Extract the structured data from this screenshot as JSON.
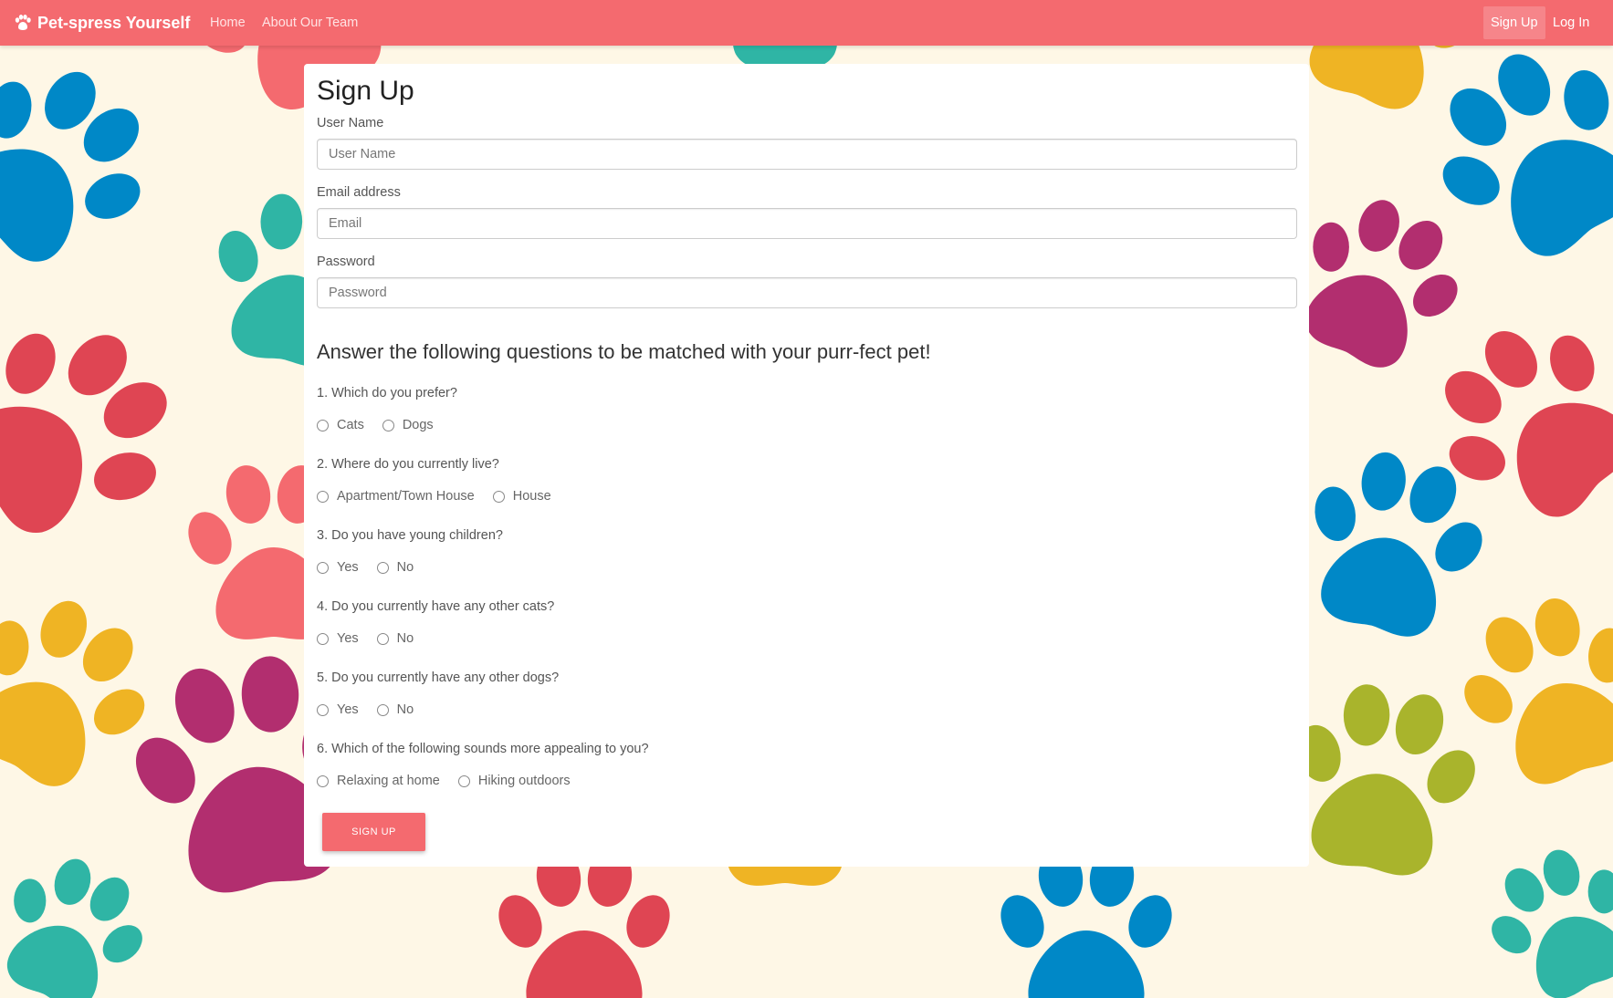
{
  "colors": {
    "brand": "#f46a6f",
    "background": "#fef7e6",
    "paw_colors": [
      "#0088c7",
      "#2fb5a5",
      "#df4553",
      "#b22e6f",
      "#f46a6f",
      "#efb424",
      "#a9b42c"
    ]
  },
  "navbar": {
    "brand_icon": "paw-icon",
    "brand": "Pet-spress Yourself",
    "links": [
      "Home",
      "About Our Team"
    ],
    "right_links": [
      "Sign Up",
      "Log In"
    ]
  },
  "form": {
    "title": "Sign Up",
    "fields": [
      {
        "label": "User Name",
        "placeholder": "User Name"
      },
      {
        "label": "Email address",
        "placeholder": "Email"
      },
      {
        "label": "Password",
        "placeholder": "Password"
      }
    ],
    "subtitle": "Answer the following questions to be matched with your purr-fect pet!",
    "questions": [
      {
        "text": "1. Which do you prefer?",
        "options": [
          "Cats",
          "Dogs"
        ]
      },
      {
        "text": "2. Where do you currently live?",
        "options": [
          "Apartment/Town House",
          "House"
        ]
      },
      {
        "text": "3. Do you have young children?",
        "options": [
          "Yes",
          "No"
        ]
      },
      {
        "text": "4. Do you currently have any other cats?",
        "options": [
          "Yes",
          "No"
        ]
      },
      {
        "text": "5. Do you currently have any other dogs?",
        "options": [
          "Yes",
          "No"
        ]
      },
      {
        "text": "6. Which of the following sounds more appealing to you?",
        "options": [
          "Relaxing at home",
          "Hiking outdoors"
        ]
      }
    ],
    "submit_label": "SIGN UP"
  }
}
